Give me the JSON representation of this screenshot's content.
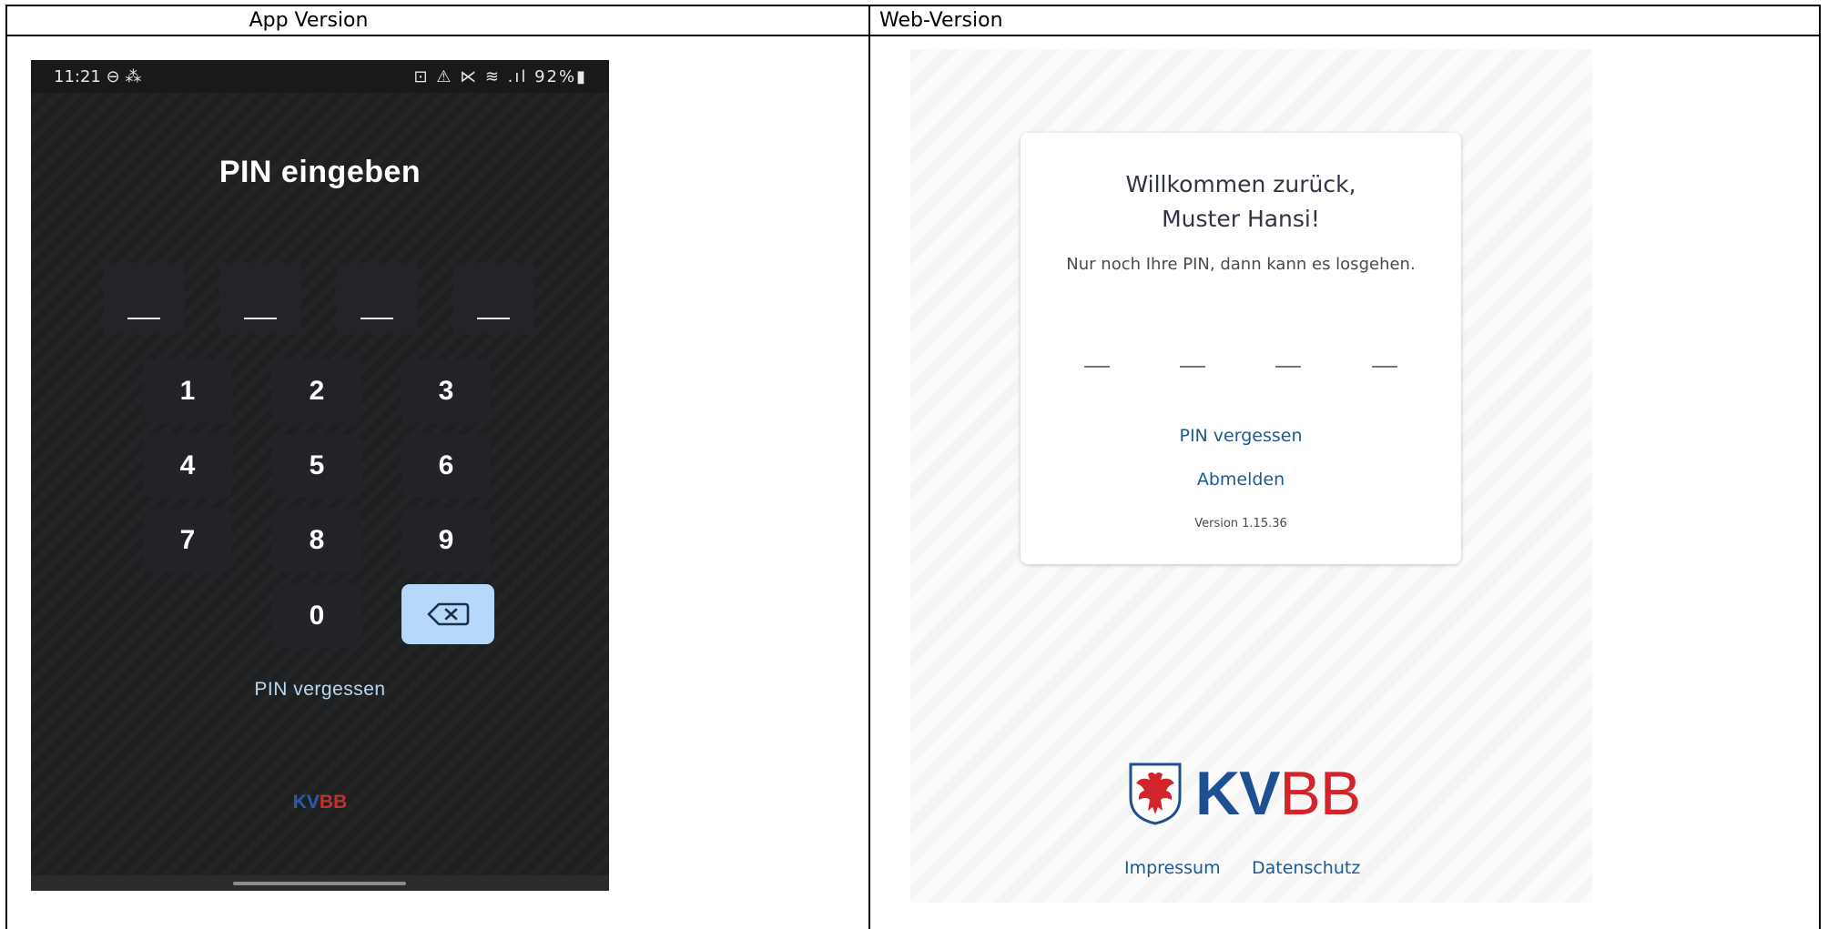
{
  "table": {
    "col_app": "App Version",
    "col_web": "Web-Version"
  },
  "app": {
    "status": {
      "time": "11:21 ⊖ ⁂",
      "right": "⊡ ⚠ ⋉ ≋ .ıl 92%▮",
      "battery": "92%"
    },
    "title": "PIN eingeben",
    "keys": [
      "1",
      "2",
      "3",
      "4",
      "5",
      "6",
      "7",
      "8",
      "9",
      "0"
    ],
    "forgot": "PIN vergessen",
    "logo_kv": "KV",
    "logo_bb": "BB",
    "colors": {
      "bg": "#1e1f21",
      "delete_key": "#b6d9fb",
      "link": "#b9d6f2"
    }
  },
  "web": {
    "welcome_line1": "Willkommen zurück,",
    "welcome_line2": "Muster Hansi!",
    "subtitle": "Nur noch Ihre PIN, dann kann es losgehen.",
    "forgot": "PIN vergessen",
    "logout": "Abmelden",
    "version": "Version 1.15.36",
    "logo_kv": "KV",
    "logo_bb": "BB",
    "impressum": "Impressum",
    "datenschutz": "Datenschutz",
    "colors": {
      "link": "#1d5a92",
      "kv": "#1d4f91",
      "bb": "#d1242b"
    }
  }
}
